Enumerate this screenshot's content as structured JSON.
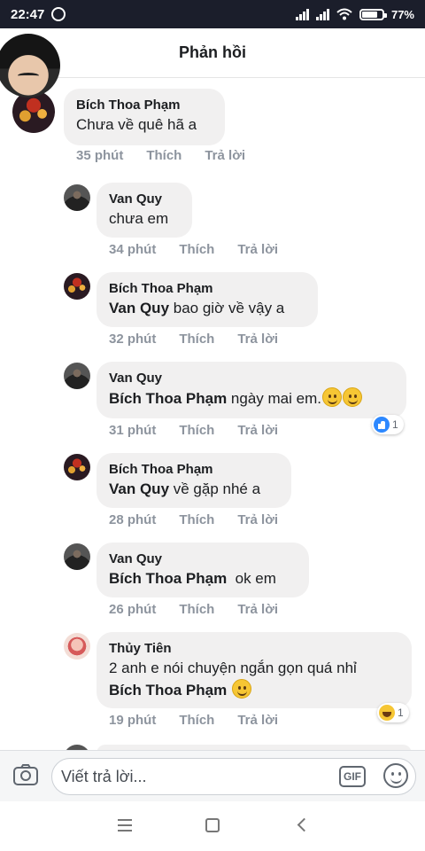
{
  "status_bar": {
    "time": "22:47",
    "battery": "77%",
    "battery_fraction": 0.77
  },
  "header": {
    "title": "Phản hồi"
  },
  "comments": [
    {
      "author": "Bích Thoa Phạm",
      "parts": [
        {
          "text": "Chưa về quê hã a"
        }
      ],
      "time": "35 phút",
      "like": "Thích",
      "reply": "Trả lời"
    },
    {
      "author": "Van Quy",
      "parts": [
        {
          "text": "chưa em"
        }
      ],
      "time": "34 phút",
      "like": "Thích",
      "reply": "Trả lời"
    },
    {
      "author": "Bích Thoa Phạm",
      "parts": [
        {
          "mention": "Van Quy"
        },
        {
          "text": " bao giờ về vậy a"
        }
      ],
      "time": "32 phút",
      "like": "Thích",
      "reply": "Trả lời"
    },
    {
      "author": "Van Quy",
      "parts": [
        {
          "mention": "Bích Thoa Phạm"
        },
        {
          "text": " ngày mai em."
        }
      ],
      "emoji_count": 2,
      "time": "31 phút",
      "like": "Thích",
      "reply": "Trả lời",
      "reaction": {
        "icon": "like-icon",
        "count": "1"
      }
    },
    {
      "author": "Bích Thoa Phạm",
      "parts": [
        {
          "mention": "Van Quy"
        },
        {
          "text": " về gặp nhé a"
        }
      ],
      "time": "28 phút",
      "like": "Thích",
      "reply": "Trả lời"
    },
    {
      "author": "Van Quy",
      "parts": [
        {
          "mention": "Bích Thoa Phạm"
        },
        {
          "text": "  ok em"
        }
      ],
      "time": "26 phút",
      "like": "Thích",
      "reply": "Trả lời"
    },
    {
      "author": "Thủy Tiên",
      "line1": "2 anh e nói chuyện ngắn gọn quá nhỉ",
      "parts": [
        {
          "mention": "Bích Thoa Phạm"
        }
      ],
      "trailing_emoji": "laughing-emoji",
      "time": "19 phút",
      "like": "Thích",
      "reply": "Trả lời",
      "reaction": {
        "icon": "haha-icon",
        "count": "1"
      }
    }
  ],
  "composer": {
    "placeholder": "Viết trả lời...",
    "gif_label": "GIF"
  }
}
